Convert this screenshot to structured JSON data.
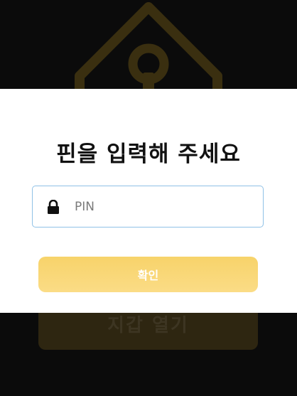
{
  "background": {
    "open_button_label": "지갑 열기",
    "logo_icon": "tag-icon",
    "accent_dim": "#2e2611"
  },
  "modal": {
    "title": "핀을 입력해 주세요",
    "pin_input": {
      "placeholder": "PIN",
      "value": "",
      "icon": "lock-icon"
    },
    "confirm_button_label": "확인",
    "accent": "#f9d77a",
    "input_border": "#8fc1e6"
  }
}
